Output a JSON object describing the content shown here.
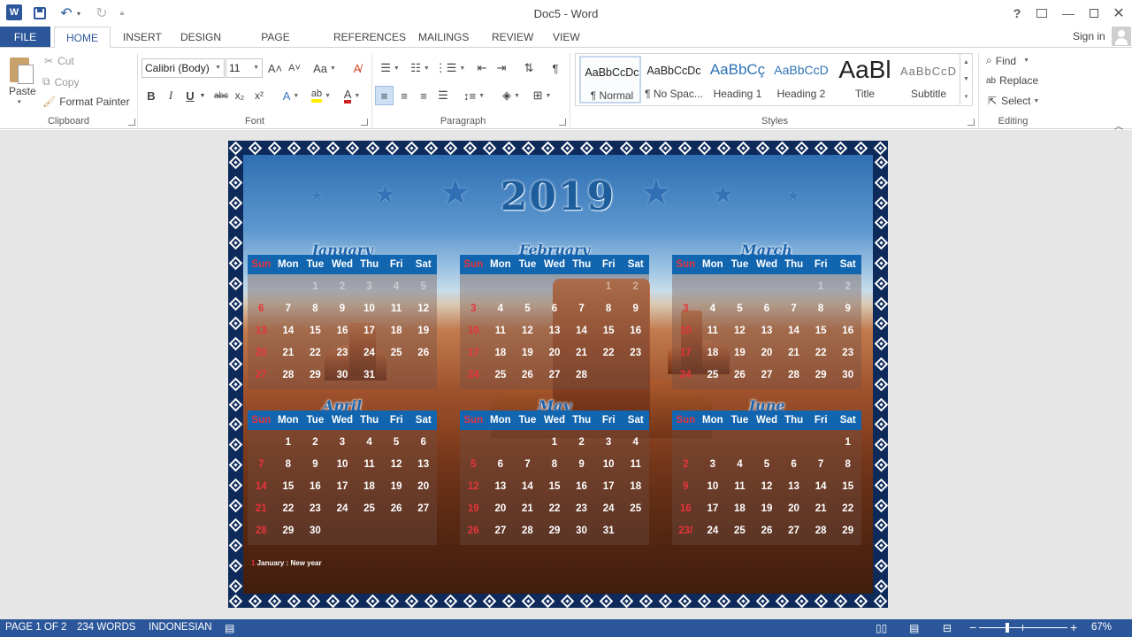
{
  "window": {
    "title": "Doc5 - Word",
    "help": "?",
    "minimize": "—",
    "close": "✕",
    "sign_in": "Sign in"
  },
  "quick_access": {
    "app_logo": "W",
    "undo": "↶",
    "redo": "↻",
    "dropdown": "▾",
    "customize": "≡"
  },
  "tabs": [
    "FILE",
    "HOME",
    "INSERT",
    "DESIGN",
    "PAGE LAYOUT",
    "REFERENCES",
    "MAILINGS",
    "REVIEW",
    "VIEW"
  ],
  "ribbon": {
    "clipboard": {
      "label": "Clipboard",
      "paste": "Paste",
      "cut": "Cut",
      "copy": "Copy",
      "format_painter": "Format Painter"
    },
    "font": {
      "label": "Font",
      "family": "Calibri (Body)",
      "size": "11",
      "grow": "A˄",
      "shrink": "A˅",
      "change_case": "Aa",
      "bold": "B",
      "italic": "I",
      "underline": "U",
      "strike": "abc",
      "subscript": "x₂",
      "superscript": "x²",
      "effects": "A",
      "highlight": "ab",
      "font_color": "A"
    },
    "paragraph": {
      "label": "Paragraph",
      "pilcrow": "¶"
    },
    "styles": {
      "label": "Styles",
      "items": [
        {
          "sample": "AaBbCcDc",
          "name": "¶ Normal"
        },
        {
          "sample": "AaBbCcDc",
          "name": "¶ No Spac..."
        },
        {
          "sample": "AaBbCç",
          "name": "Heading 1"
        },
        {
          "sample": "AaBbCcD",
          "name": "Heading 2"
        },
        {
          "sample": "AaBl",
          "name": "Title"
        },
        {
          "sample": "AaBbCcD",
          "name": "Subtitle"
        }
      ]
    },
    "editing": {
      "label": "Editing",
      "find": "Find",
      "replace": "Replace",
      "select": "Select"
    }
  },
  "calendar": {
    "year": "2019",
    "weekdays": [
      "Sun",
      "Mon",
      "Tue",
      "Wed",
      "Thu",
      "Fri",
      "Sat"
    ],
    "months": [
      {
        "name": "January",
        "days": [
          "",
          "",
          "1",
          "2",
          "3",
          "4",
          "5",
          "6",
          "7",
          "8",
          "9",
          "10",
          "11",
          "12",
          "13",
          "14",
          "15",
          "16",
          "17",
          "18",
          "19",
          "20",
          "21",
          "22",
          "23",
          "24",
          "25",
          "26",
          "27",
          "28",
          "29",
          "30",
          "31",
          "",
          ""
        ]
      },
      {
        "name": "February",
        "days": [
          "",
          "",
          "",
          "",
          "",
          "1",
          "2",
          "3",
          "4",
          "5",
          "6",
          "7",
          "8",
          "9",
          "10",
          "11",
          "12",
          "13",
          "14",
          "15",
          "16",
          "17",
          "18",
          "19",
          "20",
          "21",
          "22",
          "23",
          "24",
          "25",
          "26",
          "27",
          "28",
          "",
          ""
        ]
      },
      {
        "name": "March",
        "days": [
          "",
          "",
          "",
          "",
          "",
          "1",
          "2",
          "3",
          "4",
          "5",
          "6",
          "7",
          "8",
          "9",
          "10",
          "11",
          "12",
          "13",
          "14",
          "15",
          "16",
          "17",
          "18",
          "19",
          "20",
          "21",
          "22",
          "23",
          "24",
          "25",
          "26",
          "27",
          "28",
          "29",
          "30"
        ]
      },
      {
        "name": "April",
        "days": [
          "",
          "1",
          "2",
          "3",
          "4",
          "5",
          "6",
          "7",
          "8",
          "9",
          "10",
          "11",
          "12",
          "13",
          "14",
          "15",
          "16",
          "17",
          "18",
          "19",
          "20",
          "21",
          "22",
          "23",
          "24",
          "25",
          "26",
          "27",
          "28",
          "29",
          "30",
          "",
          "",
          "",
          ""
        ]
      },
      {
        "name": "May",
        "days": [
          "",
          "",
          "",
          "1",
          "2",
          "3",
          "4",
          "5",
          "6",
          "7",
          "8",
          "9",
          "10",
          "11",
          "12",
          "13",
          "14",
          "15",
          "16",
          "17",
          "18",
          "19",
          "20",
          "21",
          "22",
          "23",
          "24",
          "25",
          "26",
          "27",
          "28",
          "29",
          "30",
          "31",
          ""
        ]
      },
      {
        "name": "June",
        "days": [
          "",
          "",
          "",
          "",
          "",
          "",
          "1",
          "2",
          "3",
          "4",
          "5",
          "6",
          "7",
          "8",
          "9",
          "10",
          "11",
          "12",
          "13",
          "14",
          "15",
          "16",
          "17",
          "18",
          "19",
          "20",
          "21",
          "22",
          "23/",
          "24",
          "25",
          "26",
          "27",
          "28",
          "29"
        ]
      }
    ],
    "holiday_num": "1",
    "holiday_text": " January : New year"
  },
  "status": {
    "page": "PAGE 1 OF 2",
    "words": "234 WORDS",
    "language": "INDONESIAN",
    "zoom": "67%",
    "zoom_out": "−",
    "zoom_in": "+"
  },
  "colors": {
    "accent": "#2b579a",
    "calendar_header": "#1266b0",
    "sunday": "#e8343c",
    "frame": "#0e2a5a"
  }
}
